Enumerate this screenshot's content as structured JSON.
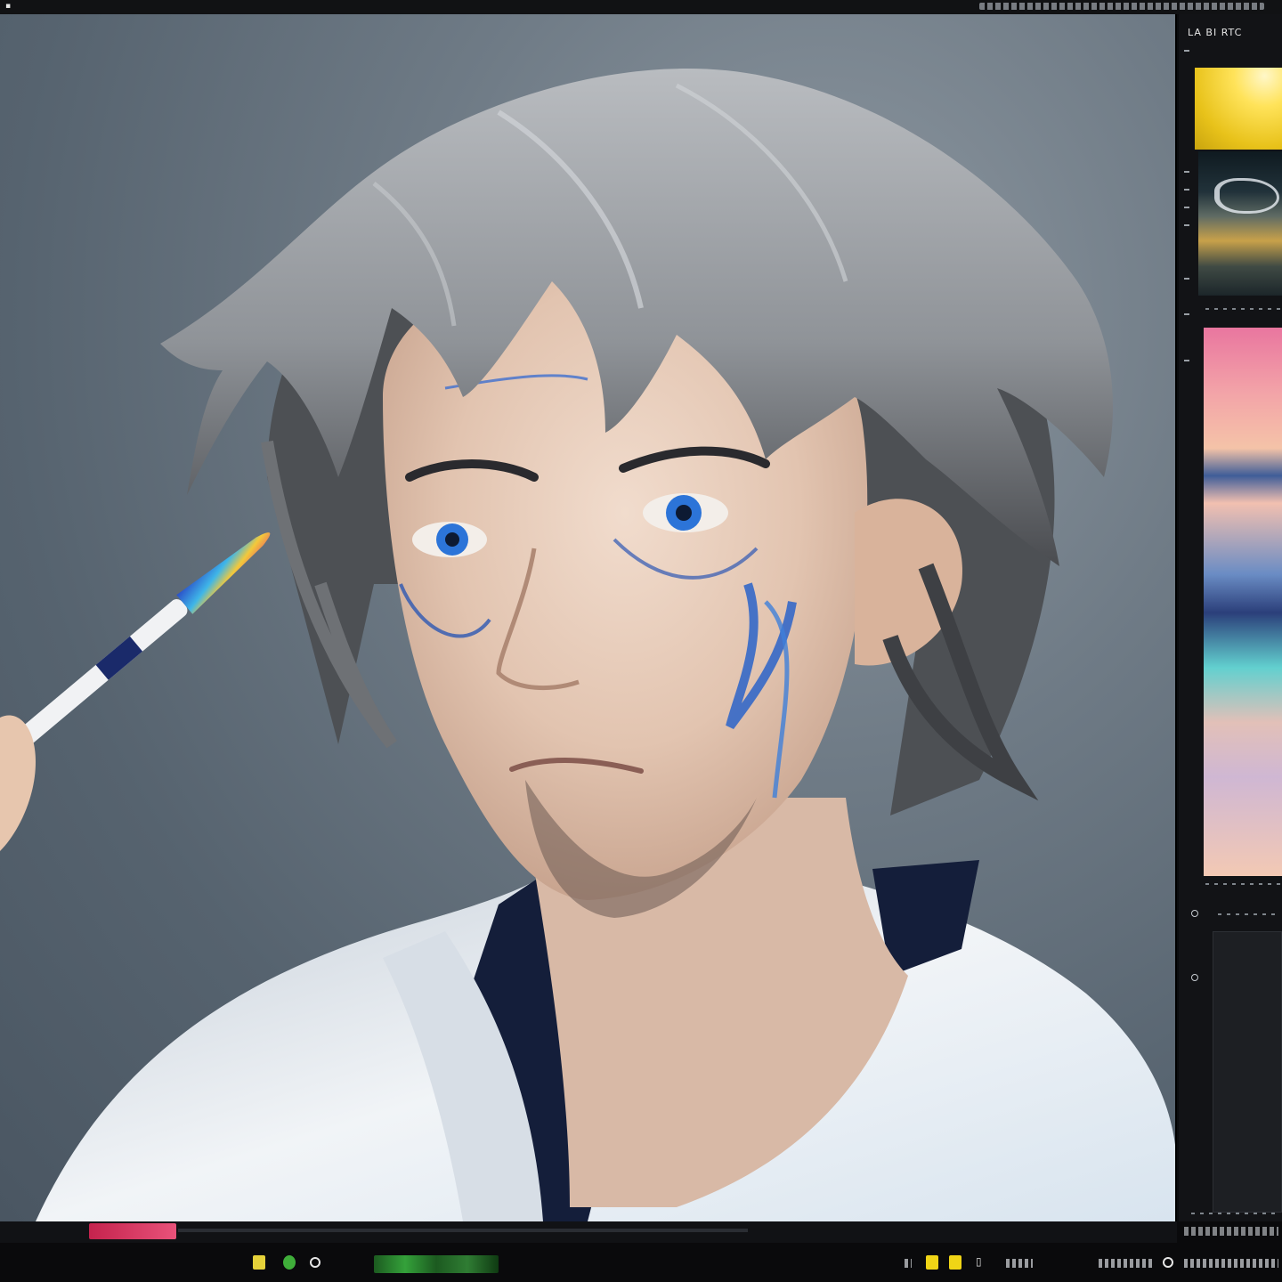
{
  "app": {
    "top_menu_icon": "app-icon",
    "top_menu_label": ""
  },
  "canvas": {
    "artwork": "portrait-illustration",
    "colors": {
      "background": "#6f7b86",
      "hair": "#9a9ea3",
      "skin": "#e6cbb8",
      "eyes": "#2c74d8",
      "paint_accent": "#2a63c9",
      "shirt": "#e9eef3",
      "collar": "#141e3a"
    }
  },
  "dock": {
    "header_label": "LA BI RTC",
    "panels": [
      {
        "name": "yellow-swatch",
        "color": "#ffe35a"
      },
      {
        "name": "reference-thumbnail"
      },
      {
        "name": "color-gradient"
      },
      {
        "name": "layers-panel"
      }
    ]
  },
  "statusbar": {
    "ruler_label": "",
    "tool_icons": [
      "brush-tool-icon",
      "color-picker-icon",
      "layer-icon"
    ],
    "right_icons": [
      "yellow-square-icon",
      "yellow-square-icon",
      "info-icon",
      "circle-icon"
    ]
  }
}
